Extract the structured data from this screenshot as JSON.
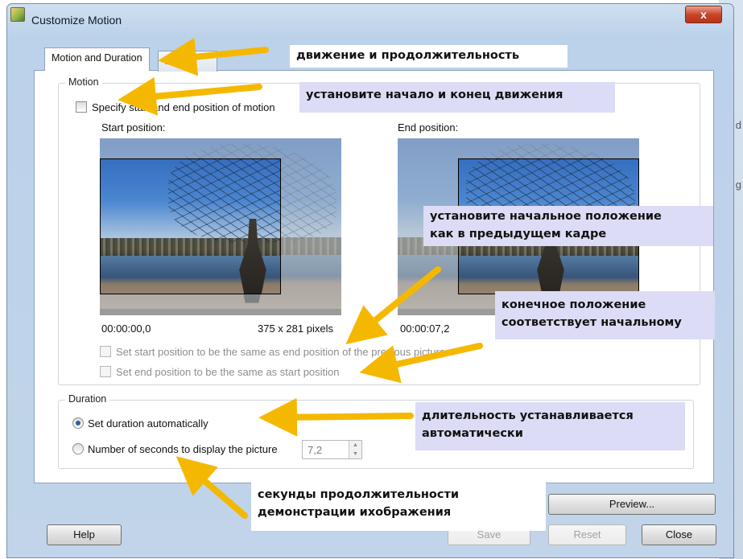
{
  "window": {
    "title": "Customize Motion",
    "close_glyph": "x",
    "icon": "app-icon"
  },
  "background_side_letters": [
    "d",
    "g"
  ],
  "tabs": [
    {
      "label": "Motion and Duration",
      "active": true
    },
    {
      "label": "Transition",
      "visible_part": "nsition",
      "active": false
    }
  ],
  "motion": {
    "legend": "Motion",
    "specify_label": "Specify start and end position of motion",
    "specify_checked": false,
    "start_label": "Start position:",
    "end_label": "End position:",
    "start_time": "00:00:00,0",
    "start_size": "375 x 281 pixels",
    "end_time": "00:00:07,2",
    "same_as_prev_label": "Set start position to be the same as end position of the previous picture",
    "same_as_start_label": "Set end position to be the same as start position"
  },
  "duration": {
    "legend": "Duration",
    "auto_label": "Set duration automatically",
    "auto_selected": true,
    "seconds_label": "Number of seconds to display the picture",
    "seconds_value": "7,2"
  },
  "buttons": {
    "preview": "Preview...",
    "help": "Help",
    "save": "Save",
    "reset": "Reset",
    "close": "Close"
  },
  "annotations": {
    "motion_duration": "движение и продолжительность",
    "set_start_end": "установите начало и конец движения",
    "start_like_prev_1": "установите начальное положение",
    "start_like_prev_2": "как в предыдущем кадре",
    "end_like_start_1": "конечное положение",
    "end_like_start_2": "соответствует начальному",
    "auto_duration_1": "длительность устанавливается",
    "auto_duration_2": "автоматически",
    "seconds_1": "секунды продолжительности",
    "seconds_2": "демонстрации ихображения"
  },
  "colors": {
    "arrow": "#f5b800",
    "note_bg": "#dcdcf6",
    "radio_dot": "#2b5ea8"
  }
}
